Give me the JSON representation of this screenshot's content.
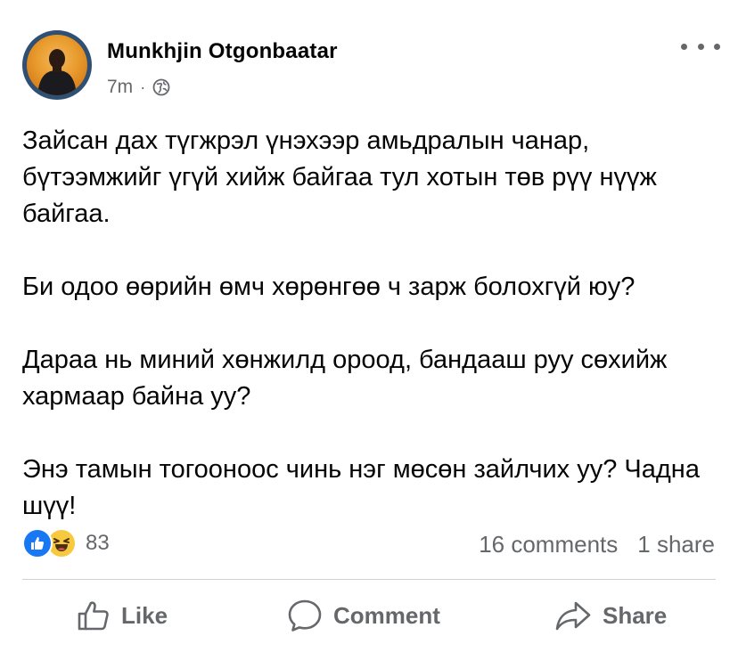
{
  "post": {
    "author": "Munkhjin Otgonbaatar",
    "time": "7m",
    "separator": "·",
    "privacy_icon": "globe-icon",
    "menu_icon": "more-horizontal-icon",
    "body": [
      "Зайсан дах түгжрэл үнэхээр амьдралын чанар, бүтээмжийг үгүй хийж байгаа тул хотын төв рүү нүүж байгаа.",
      "Би одоо өөрийн өмч хөрөнгөө ч зарж болохгүй юу?",
      "Дараа нь миний хөнжилд ороод, бандааш руу сөхийж хармаар байна уу?",
      "Энэ тамын тогооноос чинь нэг мөсөн зайлчих уу? Чадна шүү!"
    ]
  },
  "reactions": {
    "icons": [
      "like-reaction-icon",
      "haha-reaction-icon"
    ],
    "count": "83"
  },
  "stats": {
    "comments": "16 comments",
    "shares": "1 share"
  },
  "actions": {
    "like": "Like",
    "comment": "Comment",
    "share": "Share"
  },
  "colors": {
    "text": "#050505",
    "secondary": "#65676b",
    "like_blue": "#1877f2",
    "haha_yellow": "#f7c93e",
    "avatar_ring": "#2f4f73",
    "avatar_bg": "#e99a2c"
  }
}
